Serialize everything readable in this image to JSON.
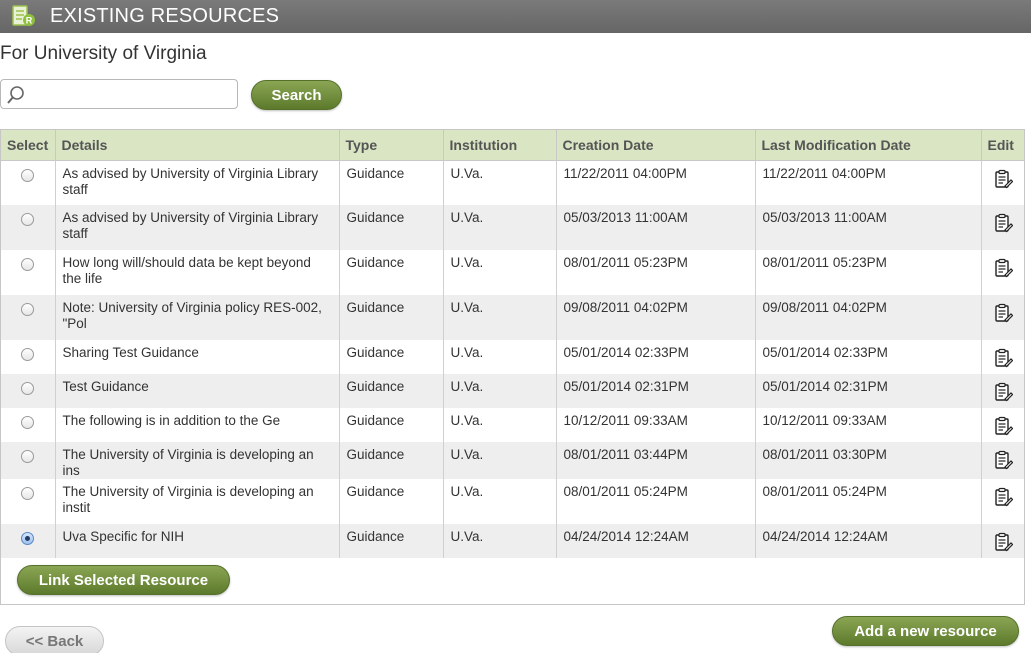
{
  "header": {
    "title": "EXISTING RESOURCES",
    "icon": "resource-doc-icon"
  },
  "subtitle": "For University of Virginia",
  "search": {
    "value": "",
    "placeholder": "",
    "button_label": "Search"
  },
  "table": {
    "columns": [
      "Select",
      "Details",
      "Type",
      "Institution",
      "Creation Date",
      "Last Modification Date",
      "Edit"
    ],
    "rows": [
      {
        "selected": false,
        "details": "As advised by University of Virginia Library staff",
        "type": "Guidance",
        "institution": "U.Va.",
        "created": "11/22/2011 04:00PM",
        "modified": "11/22/2011 04:00PM"
      },
      {
        "selected": false,
        "details": "As advised by University of Virginia Library staff",
        "type": "Guidance",
        "institution": "U.Va.",
        "created": "05/03/2013 11:00AM",
        "modified": "05/03/2013 11:00AM"
      },
      {
        "selected": false,
        "details": "How long will/should data be kept beyond the life",
        "type": "Guidance",
        "institution": "U.Va.",
        "created": "08/01/2011 05:23PM",
        "modified": "08/01/2011 05:23PM"
      },
      {
        "selected": false,
        "details": "Note: University of Virginia policy RES-002, \"Pol",
        "type": "Guidance",
        "institution": "U.Va.",
        "created": "09/08/2011 04:02PM",
        "modified": "09/08/2011 04:02PM"
      },
      {
        "selected": false,
        "details": "Sharing Test Guidance",
        "type": "Guidance",
        "institution": "U.Va.",
        "created": "05/01/2014 02:33PM",
        "modified": "05/01/2014 02:33PM"
      },
      {
        "selected": false,
        "details": "Test Guidance",
        "type": "Guidance",
        "institution": "U.Va.",
        "created": "05/01/2014 02:31PM",
        "modified": "05/01/2014 02:31PM"
      },
      {
        "selected": false,
        "details": "The following is in addition to the Ge",
        "type": "Guidance",
        "institution": "U.Va.",
        "created": "10/12/2011 09:33AM",
        "modified": "10/12/2011 09:33AM"
      },
      {
        "selected": false,
        "details": "The University of Virginia is developing an ins",
        "type": "Guidance",
        "institution": "U.Va.",
        "created": "08/01/2011 03:44PM",
        "modified": "08/01/2011 03:30PM"
      },
      {
        "selected": false,
        "details": "The University of Virginia is developing an instit",
        "type": "Guidance",
        "institution": "U.Va.",
        "created": "08/01/2011 05:24PM",
        "modified": "08/01/2011 05:24PM"
      },
      {
        "selected": true,
        "details": "Uva Specific for NIH",
        "type": "Guidance",
        "institution": "U.Va.",
        "created": "04/24/2014 12:24AM",
        "modified": "04/24/2014 12:24AM"
      }
    ]
  },
  "buttons": {
    "link_selected": "Link Selected Resource",
    "add_new": "Add a new resource",
    "back": "<< Back"
  },
  "colors": {
    "header_bg": "#6e6e6e",
    "button_green": "#6f8c3a",
    "table_header_bg": "#d9e5c3"
  }
}
